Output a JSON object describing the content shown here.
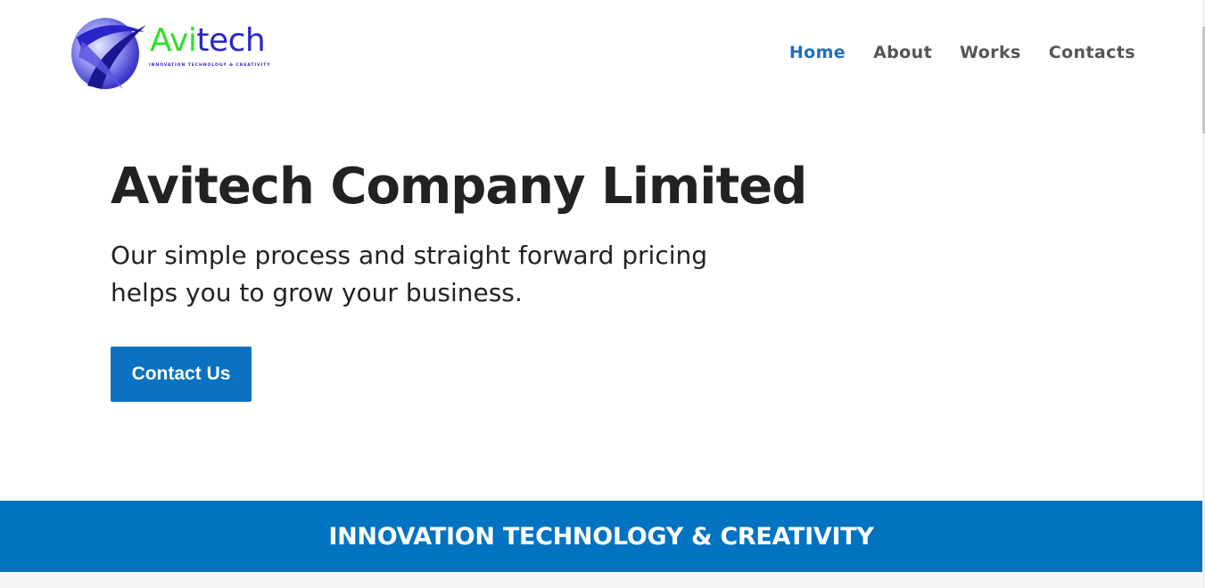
{
  "header": {
    "logo": {
      "word_part1": "Avi",
      "word_part2": "tech",
      "tagline": "INNOVATION TECHNOLOGY & CREATIVITY",
      "icon": "globe-swoosh-logo-icon"
    },
    "nav": [
      {
        "label": "Home",
        "active": true
      },
      {
        "label": "About",
        "active": false
      },
      {
        "label": "Works",
        "active": false
      },
      {
        "label": "Contacts",
        "active": false
      }
    ]
  },
  "hero": {
    "title": "Avitech Company Limited",
    "subtitle_line1": "Our simple process and straight forward pricing",
    "subtitle_line2": "helps you to grow your business.",
    "cta_label": "Contact Us"
  },
  "band": {
    "text": "INNOVATION TECHNOLOGY & CREATIVITY"
  },
  "colors": {
    "primary": "#0173c1",
    "nav_active": "#1f6fb7",
    "nav_default": "#555555",
    "heading": "#222222",
    "logo_green": "#2ee02a",
    "logo_blue": "#2a25c9"
  }
}
